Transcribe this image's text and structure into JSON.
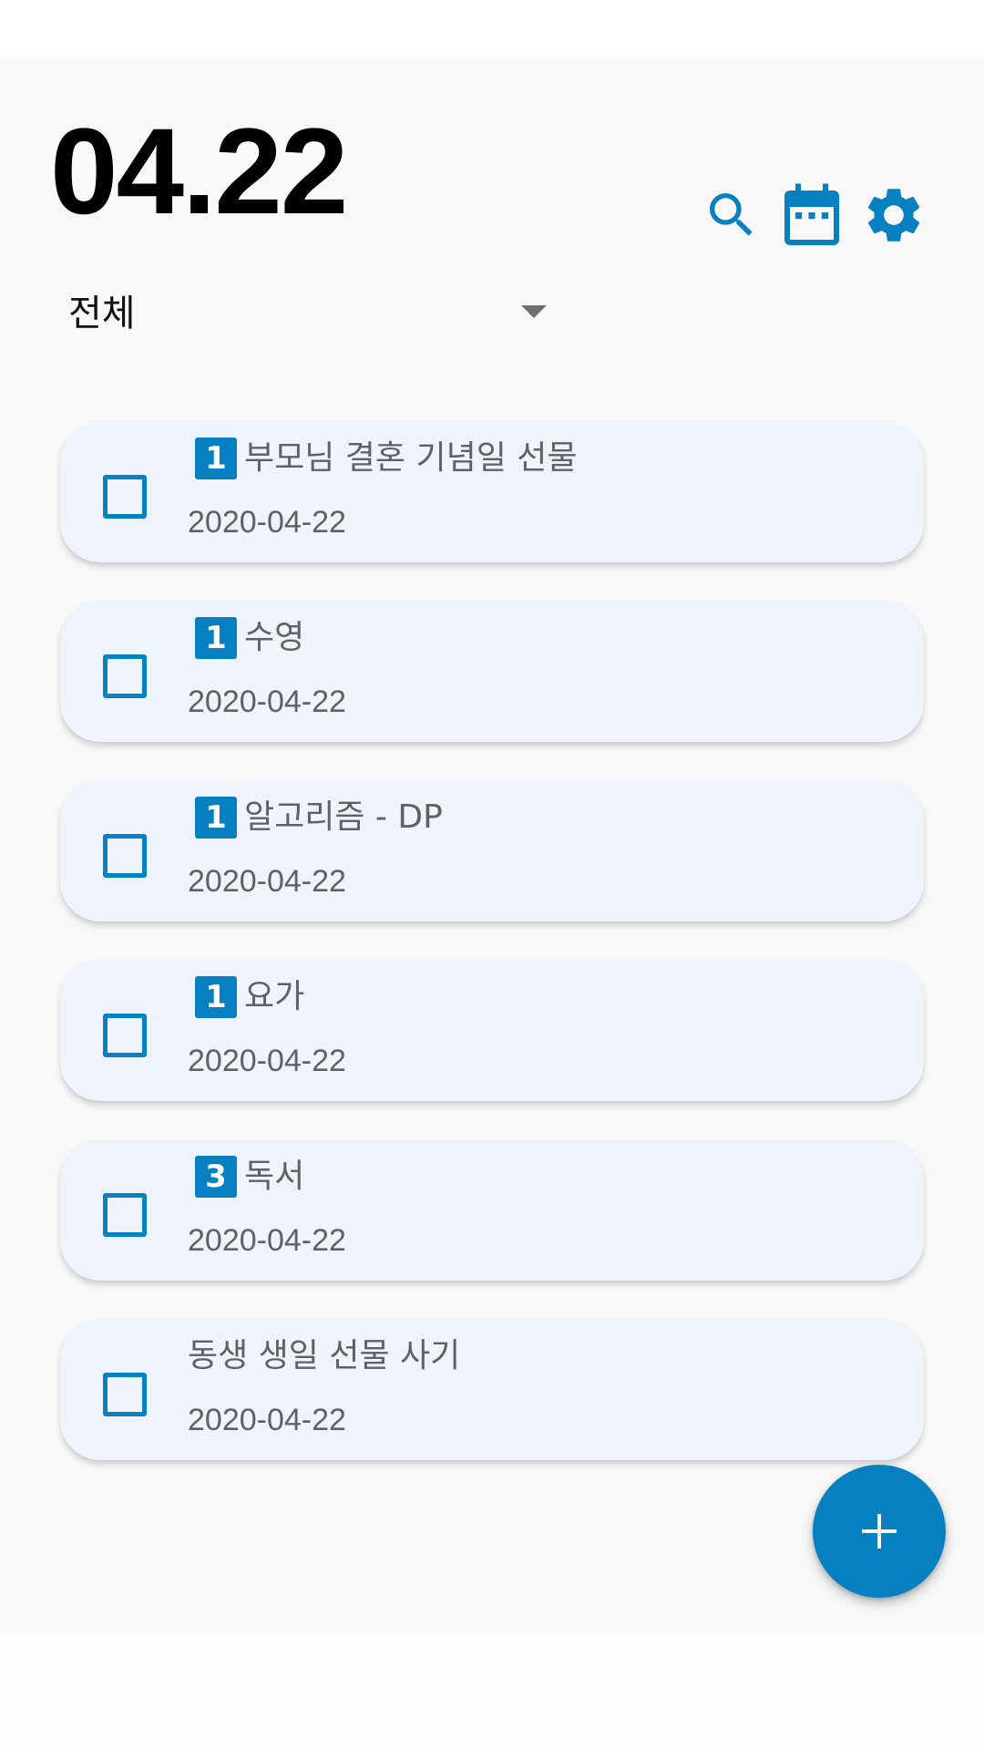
{
  "header": {
    "date": "04.22",
    "icons": [
      "search-icon",
      "calendar-icon",
      "gear-icon"
    ]
  },
  "filter": {
    "selected": "전체"
  },
  "todos": [
    {
      "priority": "1",
      "title": "부모님 결혼 기념일 선물",
      "date": "2020-04-22",
      "checked": false
    },
    {
      "priority": "1",
      "title": "수영",
      "date": "2020-04-22",
      "checked": false
    },
    {
      "priority": "1",
      "title": "알고리즘 - DP",
      "date": "2020-04-22",
      "checked": false
    },
    {
      "priority": "1",
      "title": "요가",
      "date": "2020-04-22",
      "checked": false
    },
    {
      "priority": "3",
      "title": "독서",
      "date": "2020-04-22",
      "checked": false
    },
    {
      "priority": "",
      "title": "동생 생일 선물 사기",
      "date": "2020-04-22",
      "checked": false
    }
  ],
  "fab": {
    "icon": "plus-icon"
  },
  "colors": {
    "accent": "#0780c2",
    "card_background": "#eff3fc",
    "app_background": "#f8f8f8",
    "text_secondary": "#5f6166"
  }
}
